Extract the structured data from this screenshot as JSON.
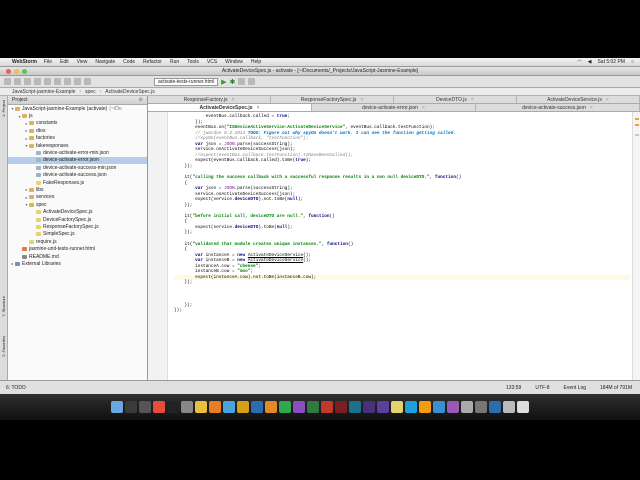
{
  "menubar": {
    "app_name": "WebStorm",
    "items": [
      "File",
      "Edit",
      "View",
      "Navigate",
      "Code",
      "Refactor",
      "Run",
      "Tools",
      "VCS",
      "Window",
      "Help"
    ],
    "clock": "Sat 5:02 PM"
  },
  "window": {
    "title": "ActivateDeviceSpec.js - activate - [~/Documents/_Projects/JavaScript-Jasmine-Example]"
  },
  "toolbar": {
    "run_config": "activate-tests-runner.html"
  },
  "breadcrumb": [
    "JavaScript-jasmine-Example",
    "spec",
    "ActivateDeviceSpec.js"
  ],
  "project_panel": {
    "title": "Project",
    "root": "JavaScript-jasmine-Example (activate)",
    "root_path": "(~/Do",
    "tree": [
      {
        "depth": 1,
        "label": "js",
        "type": "folder",
        "toggle": "▾"
      },
      {
        "depth": 2,
        "label": "constants",
        "type": "folder",
        "toggle": "▸"
      },
      {
        "depth": 2,
        "label": "dtos",
        "type": "folder",
        "toggle": "▸"
      },
      {
        "depth": 2,
        "label": "factories",
        "type": "folder",
        "toggle": "▸"
      },
      {
        "depth": 2,
        "label": "fakeresponses",
        "type": "folder",
        "toggle": "▾"
      },
      {
        "depth": 3,
        "label": "device-activate-error-min.json",
        "type": "json",
        "toggle": ""
      },
      {
        "depth": 3,
        "label": "device-activate-error.json",
        "type": "json",
        "toggle": "",
        "selected": true
      },
      {
        "depth": 3,
        "label": "device-activate-success-min.json",
        "type": "json",
        "toggle": ""
      },
      {
        "depth": 3,
        "label": "device-activate-success.json",
        "type": "json",
        "toggle": ""
      },
      {
        "depth": 3,
        "label": "FakeResponses.js",
        "type": "js",
        "toggle": ""
      },
      {
        "depth": 2,
        "label": "libs",
        "type": "folder",
        "toggle": "▸"
      },
      {
        "depth": 2,
        "label": "services",
        "type": "folder",
        "toggle": "▸"
      },
      {
        "depth": 2,
        "label": "spec",
        "type": "folder",
        "toggle": "▾"
      },
      {
        "depth": 3,
        "label": "ActivateDeviceSpec.js",
        "type": "js",
        "toggle": ""
      },
      {
        "depth": 3,
        "label": "DeviceFactorySpec.js",
        "type": "js",
        "toggle": ""
      },
      {
        "depth": 3,
        "label": "ResponseFactorySpec.js",
        "type": "js",
        "toggle": ""
      },
      {
        "depth": 3,
        "label": "SimpleSpec.js",
        "type": "js",
        "toggle": ""
      },
      {
        "depth": 2,
        "label": "require.js",
        "type": "js",
        "toggle": ""
      },
      {
        "depth": 1,
        "label": "jasmine-unit-tests-runner.html",
        "type": "html",
        "toggle": ""
      },
      {
        "depth": 1,
        "label": "README.md",
        "type": "md",
        "toggle": ""
      },
      {
        "depth": 0,
        "label": "External Libraries",
        "type": "lib",
        "toggle": "▸"
      }
    ]
  },
  "editor": {
    "tabs_row1": [
      {
        "label": "ResponseFactory.js",
        "active": false
      },
      {
        "label": "ResponseFactorySpec.js",
        "active": false
      },
      {
        "label": "DeviceDTO.js",
        "active": false
      },
      {
        "label": "ActivateDeviceService.js",
        "active": false
      }
    ],
    "tabs_row2": [
      {
        "label": "ActivateDeviceSpec.js",
        "active": true
      },
      {
        "label": "device-activate-error.json",
        "active": false
      },
      {
        "label": "device-activate-success.json",
        "active": false
      }
    ],
    "code_lines": [
      [
        [
          "",
          "            eventBus.callback.called = "
        ],
        [
          "kw",
          "true"
        ],
        [
          "",
          ";"
        ]
      ],
      [
        [
          "",
          "        });"
        ]
      ],
      [
        [
          "",
          "        eventBus.on("
        ],
        [
          "st",
          "\"ISDeviceActiveService:ActivateDeviceService\""
        ],
        [
          "",
          ", eventBus.callback.testFunction);"
        ]
      ],
      [
        [
          "cm",
          "        // jwardon 9.2.2013 "
        ],
        [
          "td",
          "TODO: Figure out why spyOn doesn't work. I can see the function getting called."
        ]
      ],
      [
        [
          "cm",
          "        //spyOn(eventBus.callback, \"testFunction\");"
        ]
      ],
      [
        [
          "",
          "        "
        ],
        [
          "kw",
          "var"
        ],
        [
          "",
          " json = "
        ],
        [
          "fn",
          "JSON"
        ],
        [
          "",
          ".parse(successString);"
        ]
      ],
      [
        [
          "",
          "        service.onActivateDeviceSuccess(json);"
        ]
      ],
      [
        [
          "cm",
          "        //expect(eventBus.callback.testFunction).toHaveBeenCalled();"
        ]
      ],
      [
        [
          "",
          "        expect(eventBus.callback.called).toBe("
        ],
        [
          "kw",
          "true"
        ],
        [
          "",
          ");"
        ]
      ],
      [
        [
          "",
          "    });"
        ]
      ],
      [
        [
          "",
          ""
        ]
      ],
      [
        [
          "",
          "    it("
        ],
        [
          "st",
          "\"calling the success callback with a successful response results in a non null deviceDTO.\""
        ],
        [
          "",
          ", "
        ],
        [
          "kw",
          "function"
        ],
        [
          "",
          "()"
        ]
      ],
      [
        [
          "",
          "    {"
        ]
      ],
      [
        [
          "",
          "        "
        ],
        [
          "kw",
          "var"
        ],
        [
          "",
          " json = "
        ],
        [
          "fn",
          "JSON"
        ],
        [
          "",
          ".parse(successString);"
        ]
      ],
      [
        [
          "",
          "        service.onActivateDeviceSuccess(json);"
        ]
      ],
      [
        [
          "",
          "        expect(service."
        ],
        [
          "kw",
          "deviceDTO"
        ],
        [
          "",
          ").not.toBe("
        ],
        [
          "kw",
          "null"
        ],
        [
          "",
          ");"
        ]
      ],
      [
        [
          "",
          "    });"
        ]
      ],
      [
        [
          "",
          ""
        ]
      ],
      [
        [
          "",
          "    it("
        ],
        [
          "st",
          "\"before initial call, deviceDTO are null.\""
        ],
        [
          "",
          ", "
        ],
        [
          "kw",
          "function"
        ],
        [
          "",
          "()"
        ]
      ],
      [
        [
          "",
          "    {"
        ]
      ],
      [
        [
          "",
          "        expect(service."
        ],
        [
          "kw",
          "deviceDTO"
        ],
        [
          "",
          ").toBe("
        ],
        [
          "kw",
          "null"
        ],
        [
          "",
          ");"
        ]
      ],
      [
        [
          "",
          "    });"
        ]
      ],
      [
        [
          "",
          ""
        ]
      ],
      [
        [
          "",
          "    it("
        ],
        [
          "st",
          "\"validated that module creates unique instances.\""
        ],
        [
          "",
          ", "
        ],
        [
          "kw",
          "function"
        ],
        [
          "",
          "()"
        ]
      ],
      [
        [
          "",
          "    {"
        ]
      ],
      [
        [
          "",
          "        "
        ],
        [
          "kw",
          "var"
        ],
        [
          "",
          " instanceA = "
        ],
        [
          "kw",
          "new"
        ],
        [
          "",
          " "
        ],
        [
          "ul",
          "ActivateDeviceService"
        ],
        [
          "",
          "();"
        ]
      ],
      [
        [
          "",
          "        "
        ],
        [
          "kw",
          "var"
        ],
        [
          "",
          " instanceB = "
        ],
        [
          "kw",
          "new"
        ],
        [
          "",
          " "
        ],
        [
          "ul",
          "ActivateDeviceService"
        ],
        [
          "",
          "();"
        ]
      ],
      [
        [
          "",
          "        instanceA.cow = "
        ],
        [
          "st",
          "\"cheese\""
        ],
        [
          "",
          ";"
        ]
      ],
      [
        [
          "",
          "        instanceB.cow = "
        ],
        [
          "st",
          "\"moo\""
        ],
        [
          "",
          ";"
        ]
      ],
      [
        [
          "",
          "        expect(instanceA.cow).not.toBe(instanceB.cow);"
        ]
      ],
      [
        [
          "",
          "    });"
        ]
      ],
      [
        [
          "",
          ""
        ]
      ],
      [
        [
          "",
          ""
        ]
      ],
      [
        [
          "",
          ""
        ]
      ],
      [
        [
          "",
          "    });"
        ]
      ],
      [
        [
          "",
          "});"
        ]
      ]
    ],
    "current_line_index": 29
  },
  "statusbar": {
    "todo": "6: TODO",
    "position": "133:59",
    "encoding": "UTF-8",
    "event_log": "Event Log",
    "memory": "184M of 791M"
  },
  "colors": {
    "menubar_bg": "#e8e8e8",
    "selection": "#b5cde8",
    "keyword": "#000080",
    "string": "#008000",
    "comment": "#808080",
    "todo": "#0073bf",
    "current_line": "#fffae3"
  },
  "dock_icons": [
    "finder-icon",
    "dashboard-icon",
    "mission-control-icon",
    "calendar-icon",
    "terminal-icon",
    "preferences-icon",
    "chrome-icon",
    "firefox-icon",
    "safari-icon",
    "fireworks-icon",
    "photoshop-icon",
    "illustrator-icon",
    "webstorm-icon",
    "phpstorm-icon",
    "dreamweaver-icon",
    "flash-icon",
    "flashbuilder-icon",
    "audition-icon",
    "premiere-icon",
    "aftereffects-icon",
    "notes-icon",
    "skype-icon",
    "vlc-icon",
    "iphoto-icon",
    "itunes-icon",
    "app-icon",
    "app-icon",
    "photoshop-icon",
    "downloads-icon",
    "trash-icon"
  ]
}
